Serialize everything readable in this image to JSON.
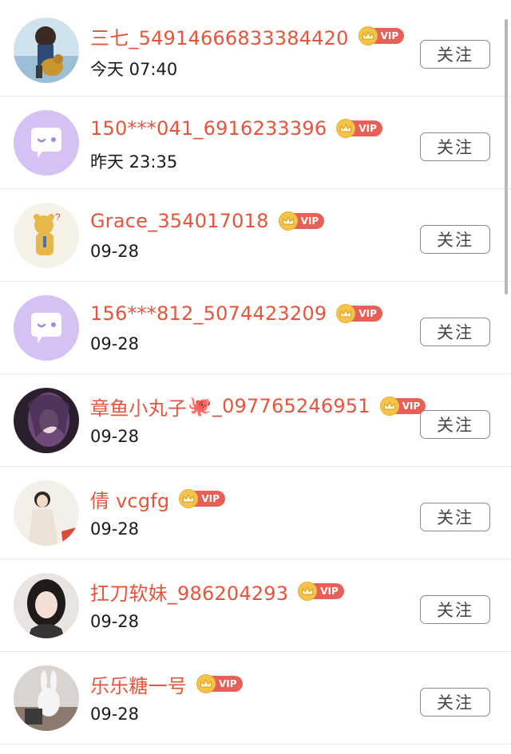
{
  "follow_label": "关注",
  "vip_label": "VIP",
  "users": [
    {
      "name": "三七_54914666833384420",
      "time": "今天 07:40",
      "avatar": "photo-girl-with-dog"
    },
    {
      "name": "150***041_6916233396",
      "time": "昨天 23:35",
      "avatar": "default-chat-bubble"
    },
    {
      "name": "Grace_354017018",
      "time": "09-28",
      "avatar": "bear-cartoon"
    },
    {
      "name": "156***812_5074423209",
      "time": "09-28",
      "avatar": "default-chat-bubble"
    },
    {
      "name": "章鱼小丸子",
      "emoji": "🐙",
      "name_suffix": "_097765246951",
      "time": "09-28",
      "avatar": "anime-girl-purple"
    },
    {
      "name": "倩 vcgfg",
      "time": "09-28",
      "avatar": "photo-costume-woman"
    },
    {
      "name": "扛刀软妹_986204293",
      "time": "09-28",
      "avatar": "photo-girl-portrait"
    },
    {
      "name": "乐乐糖一号",
      "time": "09-28",
      "avatar": "photo-rabbit-plush"
    }
  ],
  "colors": {
    "name": "#e8543a",
    "vip_tag": "#e85f58",
    "crown": "#f4c44a",
    "default_avatar": "#d6c1f5"
  }
}
